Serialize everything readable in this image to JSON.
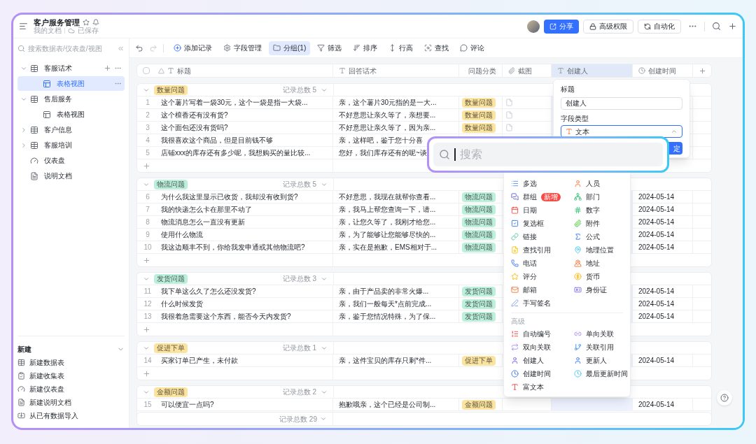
{
  "header": {
    "title": "客户服务管理",
    "location": "我的文档",
    "save_status": "已保存",
    "buttons": [
      {
        "label": "分享",
        "kind": "primary"
      },
      {
        "label": "高级权限",
        "kind": "lock"
      },
      {
        "label": "自动化",
        "kind": "automation"
      }
    ]
  },
  "sidebar": {
    "search_placeholder": "搜索数据表/仪表盘/视图",
    "tree": [
      {
        "label": "客服话术",
        "kind": "table",
        "expanded": true,
        "selected": false,
        "children": [
          {
            "label": "表格视图",
            "kind": "view",
            "selected": true
          }
        ]
      },
      {
        "label": "售后服务",
        "kind": "table",
        "expanded": true,
        "selected": false,
        "children": [
          {
            "label": "表格视图",
            "kind": "view",
            "selected": false
          }
        ]
      },
      {
        "label": "客户信息",
        "kind": "table",
        "expanded": false,
        "selected": false
      },
      {
        "label": "客服培训",
        "kind": "table",
        "expanded": false,
        "selected": false
      },
      {
        "label": "仪表盘",
        "kind": "dashboard",
        "selected": false
      },
      {
        "label": "说明文档",
        "kind": "doc",
        "selected": false
      }
    ],
    "new_section": {
      "title": "新建",
      "expanded": true,
      "items": [
        "新建数据表",
        "新建收集表",
        "新建仪表盘",
        "新建说明文档",
        "从已有数据导入"
      ]
    }
  },
  "toolbar": [
    {
      "label": "添加记录",
      "selected": false
    },
    {
      "label": "字段管理",
      "selected": false
    },
    {
      "label": "分组(1)",
      "selected": true
    },
    {
      "label": "筛选",
      "selected": false
    },
    {
      "label": "排序",
      "selected": false
    },
    {
      "label": "行高",
      "selected": false
    },
    {
      "label": "查找",
      "selected": false
    },
    {
      "label": "评论",
      "selected": false
    }
  ],
  "table": {
    "columns": [
      {
        "label": "标题",
        "selected": false
      },
      {
        "label": "回答话术",
        "selected": false
      },
      {
        "label": "问题分类",
        "selected": false
      },
      {
        "label": "截图",
        "selected": false
      },
      {
        "label": "创建人",
        "selected": true
      },
      {
        "label": "创建时间",
        "selected": false
      }
    ],
    "groups": [
      {
        "label": "数量问题",
        "color": "#fbe3a0",
        "count_label": "记录总数 5",
        "rows": [
          {
            "number": "1",
            "title": "这个薯片写着一袋30元，这个一袋是指一大袋...",
            "answer": "亲，这个薯片30元指的是一大...",
            "category": "数量问题",
            "screenshot": true
          },
          {
            "number": "2",
            "title": "这个檀香还有没有货?",
            "answer": "不好意思让亲久等了，亲想要...",
            "category": "数量问题",
            "screenshot": true
          },
          {
            "number": "3",
            "title": "这个面包还没有货吗?",
            "answer": "不好意思让亲久等了，因为亲...",
            "category": "数量问题",
            "screenshot": true
          },
          {
            "number": "4",
            "title": "我很喜欢这个商品，但是目前钱不够",
            "answer": "亲，这样吧，鉴于您十分喜"
          },
          {
            "number": "5",
            "title": "店铺xxx的库存还有多少呢，我想购买的量比较...",
            "answer": "您好，我们库存还有的呢~谈"
          }
        ]
      },
      {
        "label": "物流问题",
        "color": "#bdf0dc",
        "count_label": "记录总数 5",
        "rows": [
          {
            "number": "6",
            "title": "为什么我这里显示已收货，我却没有收到货?",
            "answer": "不好意思，我现在就帮你查看...",
            "category": "物流问题",
            "created": "2024-05-14"
          },
          {
            "number": "7",
            "title": "我的快递怎么卡在那里不动了",
            "answer": "亲，我马上帮您查询一下，请...",
            "category": "物流问题",
            "created": "2024-05-14"
          },
          {
            "number": "8",
            "title": "物流消息怎么一直没有更新",
            "answer": "亲，让您久等了，我刚才给您...",
            "category": "物流问题",
            "created": "2024-05-14"
          },
          {
            "number": "9",
            "title": "使用什么物流",
            "answer": "亲，为了能够让您能够尽快的...",
            "category": "物流问题",
            "created": "2024-05-14"
          },
          {
            "number": "10",
            "title": "我这边顺丰不到，你给我发申通或其他物流吧?",
            "answer": "亲，实在是抱歉，EMS相对于...",
            "category": "物流问题",
            "created": "2024-05-14"
          }
        ]
      },
      {
        "label": "发货问题",
        "color": "#bdf0dc",
        "count_label": "记录总数 3",
        "rows": [
          {
            "number": "11",
            "title": "我下单这么久了怎么还没发货?",
            "answer": "亲，由于产品卖的非常火爆...",
            "category": "发货问题",
            "created": "2024-05-14"
          },
          {
            "number": "12",
            "title": "什么时候发货",
            "answer": "亲，我们一般每天*点前完成...",
            "category": "发货问题",
            "created": "2024-05-14"
          },
          {
            "number": "13",
            "title": "我很着急需要这个东西，能否今天内发货?",
            "answer": "亲，鉴于您情况特殊，为了保...",
            "category": "发货问题",
            "created": "2024-05-14"
          }
        ]
      },
      {
        "label": "促进下单",
        "color": "#fbe3a0",
        "count_label": "记录总数 1",
        "rows": [
          {
            "number": "14",
            "title": "买家订单已产生，未付款",
            "answer": "亲，这件宝贝的库存只剩*件...",
            "category": "促进下单",
            "created": "2024-05-14"
          }
        ]
      },
      {
        "label": "金额问题",
        "color": "#fbe3a0",
        "count_label": "记录总数 2",
        "rows": [
          {
            "number": "15",
            "title": "可以便宜一点吗?",
            "answer": "抱歉哦亲，这个已经是公司制...",
            "category": "金额问题",
            "created": "2024-05-14"
          }
        ]
      }
    ],
    "footer": "记录总数 29"
  },
  "field_popover": {
    "title_label": "标题",
    "title_value": "创建人",
    "type_label": "字段类型",
    "type_value": "文本",
    "button": "定"
  },
  "search_overlay": {
    "placeholder": "搜索"
  },
  "field_type_menu": {
    "basic": [
      {
        "label": "多选"
      },
      {
        "label": "人员"
      },
      {
        "label": "群组",
        "badge": "新增"
      },
      {
        "label": "部门"
      },
      {
        "label": "日期"
      },
      {
        "label": "数字"
      },
      {
        "label": "复选框"
      },
      {
        "label": "附件"
      },
      {
        "label": "链接"
      },
      {
        "label": "公式"
      },
      {
        "label": "查找引用"
      },
      {
        "label": "地理位置"
      },
      {
        "label": "电话"
      },
      {
        "label": "地址"
      },
      {
        "label": "评分"
      },
      {
        "label": "货币"
      },
      {
        "label": "邮箱"
      },
      {
        "label": "身份证"
      },
      {
        "label": "手写签名"
      }
    ],
    "advanced_title": "高级",
    "advanced": [
      {
        "label": "自动编号"
      },
      {
        "label": "单向关联"
      },
      {
        "label": "双向关联"
      },
      {
        "label": "关联引用"
      },
      {
        "label": "创建人"
      },
      {
        "label": "更新人"
      },
      {
        "label": "创建时间"
      },
      {
        "label": "最后更新时间"
      },
      {
        "label": "富文本"
      }
    ]
  }
}
